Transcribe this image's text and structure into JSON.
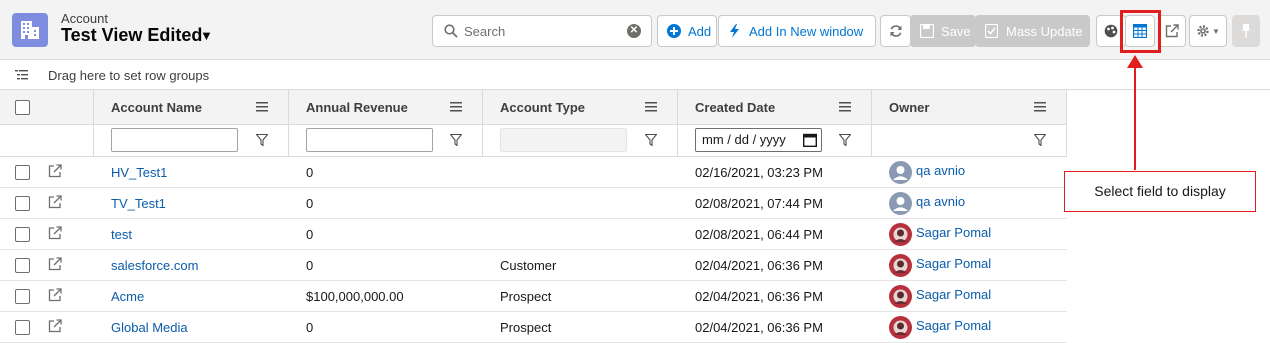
{
  "header": {
    "object_label": "Account",
    "view_title": "Test View Edited",
    "object_icon": "building-icon"
  },
  "search": {
    "placeholder": "Search",
    "value": ""
  },
  "toolbar": {
    "add_label": "Add",
    "add_new_window_label": "Add In New window",
    "save_label": "Save",
    "mass_update_label": "Mass Update"
  },
  "group_bar": {
    "text": "Drag here to set row groups"
  },
  "columns": {
    "account_name": "Account Name",
    "annual_revenue": "Annual Revenue",
    "account_type": "Account Type",
    "created_date": "Created Date",
    "owner": "Owner"
  },
  "filters": {
    "date_placeholder": "mm / dd / yyyy"
  },
  "rows": [
    {
      "name": "HV_Test1",
      "revenue": "0",
      "type": "",
      "created": "02/16/2021, 03:23 PM",
      "owner": "qa avnio",
      "avatar": "default"
    },
    {
      "name": "TV_Test1",
      "revenue": "0",
      "type": "",
      "created": "02/08/2021, 07:44 PM",
      "owner": "qa avnio",
      "avatar": "default"
    },
    {
      "name": "test",
      "revenue": "0",
      "type": "",
      "created": "02/08/2021, 06:44 PM",
      "owner": "Sagar Pomal",
      "avatar": "photo"
    },
    {
      "name": "salesforce.com",
      "revenue": "0",
      "type": "Customer",
      "created": "02/04/2021, 06:36 PM",
      "owner": "Sagar Pomal",
      "avatar": "photo"
    },
    {
      "name": "Acme",
      "revenue": "$100,000,000.00",
      "type": "Prospect",
      "created": "02/04/2021, 06:36 PM",
      "owner": "Sagar Pomal",
      "avatar": "photo"
    },
    {
      "name": "Global Media",
      "revenue": "0",
      "type": "Prospect",
      "created": "02/04/2021, 06:36 PM",
      "owner": "Sagar Pomal",
      "avatar": "photo"
    }
  ],
  "annotation": {
    "callout_text": "Select field to display"
  },
  "colors": {
    "accent": "#0176d3",
    "link": "#0b5cab",
    "callout": "#e01e1e",
    "object_icon_bg": "#7f8de1"
  }
}
